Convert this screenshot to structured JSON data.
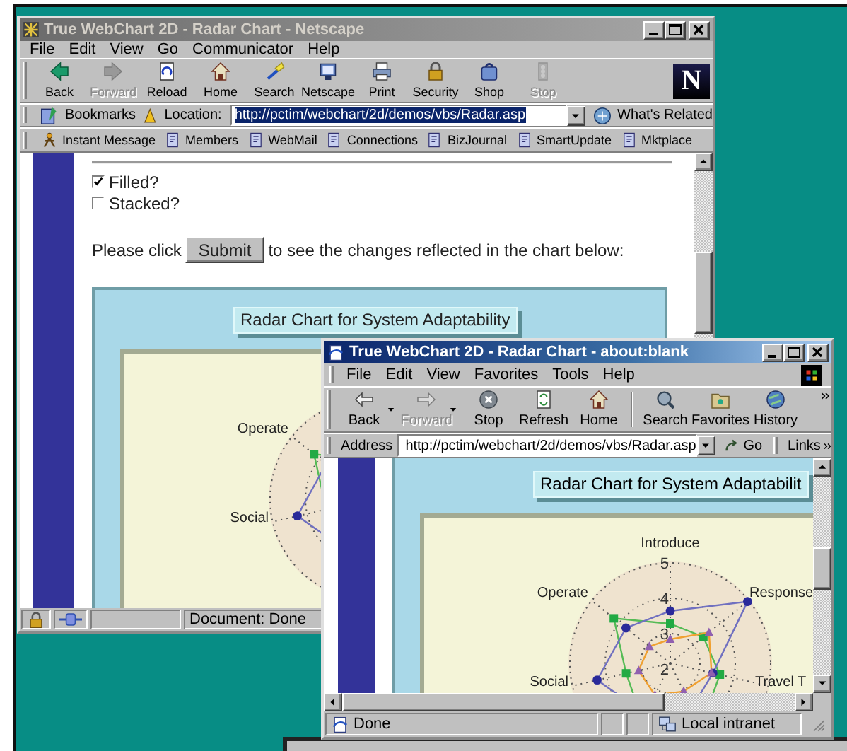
{
  "netscape": {
    "title": "True WebChart 2D - Radar Chart - Netscape",
    "active": false,
    "menu": [
      "File",
      "Edit",
      "View",
      "Go",
      "Communicator",
      "Help"
    ],
    "toolbar": [
      {
        "label": "Back",
        "disabled": false
      },
      {
        "label": "Forward",
        "disabled": true
      },
      {
        "label": "Reload",
        "disabled": false
      },
      {
        "label": "Home",
        "disabled": false
      },
      {
        "label": "Search",
        "disabled": false
      },
      {
        "label": "Netscape",
        "disabled": false
      },
      {
        "label": "Print",
        "disabled": false
      },
      {
        "label": "Security",
        "disabled": false
      },
      {
        "label": "Shop",
        "disabled": false
      },
      {
        "label": "Stop",
        "disabled": true
      }
    ],
    "logo": "N",
    "bookmarks": "Bookmarks",
    "location_label": "Location:",
    "url": "http://pctim/webchart/2d/demos/vbs/Radar.asp",
    "url_selected": true,
    "whats_related": "What's Related",
    "personal_toolbar": [
      "Instant Message",
      "Members",
      "WebMail",
      "Connections",
      "BizJournal",
      "SmartUpdate",
      "Mktplace"
    ],
    "page": {
      "options": [
        {
          "label": "Filled?",
          "checked": true
        },
        {
          "label": "Stacked?",
          "checked": false
        }
      ],
      "prompt_before": "Please click",
      "submit": "Submit",
      "prompt_after": "to see the changes reflected in the chart below:",
      "chart": {
        "title": "Radar Chart for System Adaptability",
        "axis_labels": {
          "upper_left": "Operate",
          "left": "Social"
        }
      }
    },
    "progress": {
      "level": 0
    },
    "status": "Document: Done"
  },
  "ie": {
    "title": "True WebChart 2D - Radar Chart - about:blank",
    "active": true,
    "menu": [
      "File",
      "Edit",
      "View",
      "Favorites",
      "Tools",
      "Help"
    ],
    "toolbar": [
      {
        "label": "Back",
        "disabled": false
      },
      {
        "label": "Forward",
        "disabled": true
      },
      {
        "label": "Stop",
        "disabled": false
      },
      {
        "label": "Refresh",
        "disabled": false
      },
      {
        "label": "Home",
        "disabled": false
      },
      {
        "label": "Search",
        "disabled": false
      },
      {
        "label": "Favorites",
        "disabled": false
      },
      {
        "label": "History",
        "disabled": false
      }
    ],
    "address_label": "Address",
    "url": "http://pctim/webchart/2d/demos/vbs/Radar.asp",
    "go": "Go",
    "links": "Links",
    "page": {
      "chart": {
        "title": "Radar Chart for System Adaptabilit",
        "axis_labels": {
          "top": "Introduce",
          "upper_right": "Response",
          "right": "Travel T",
          "left": "Social",
          "upper_left": "Operate"
        },
        "ticks": [
          "5",
          "4",
          "3",
          "2"
        ]
      }
    },
    "status": "Done",
    "zone": "Local intranet"
  }
}
